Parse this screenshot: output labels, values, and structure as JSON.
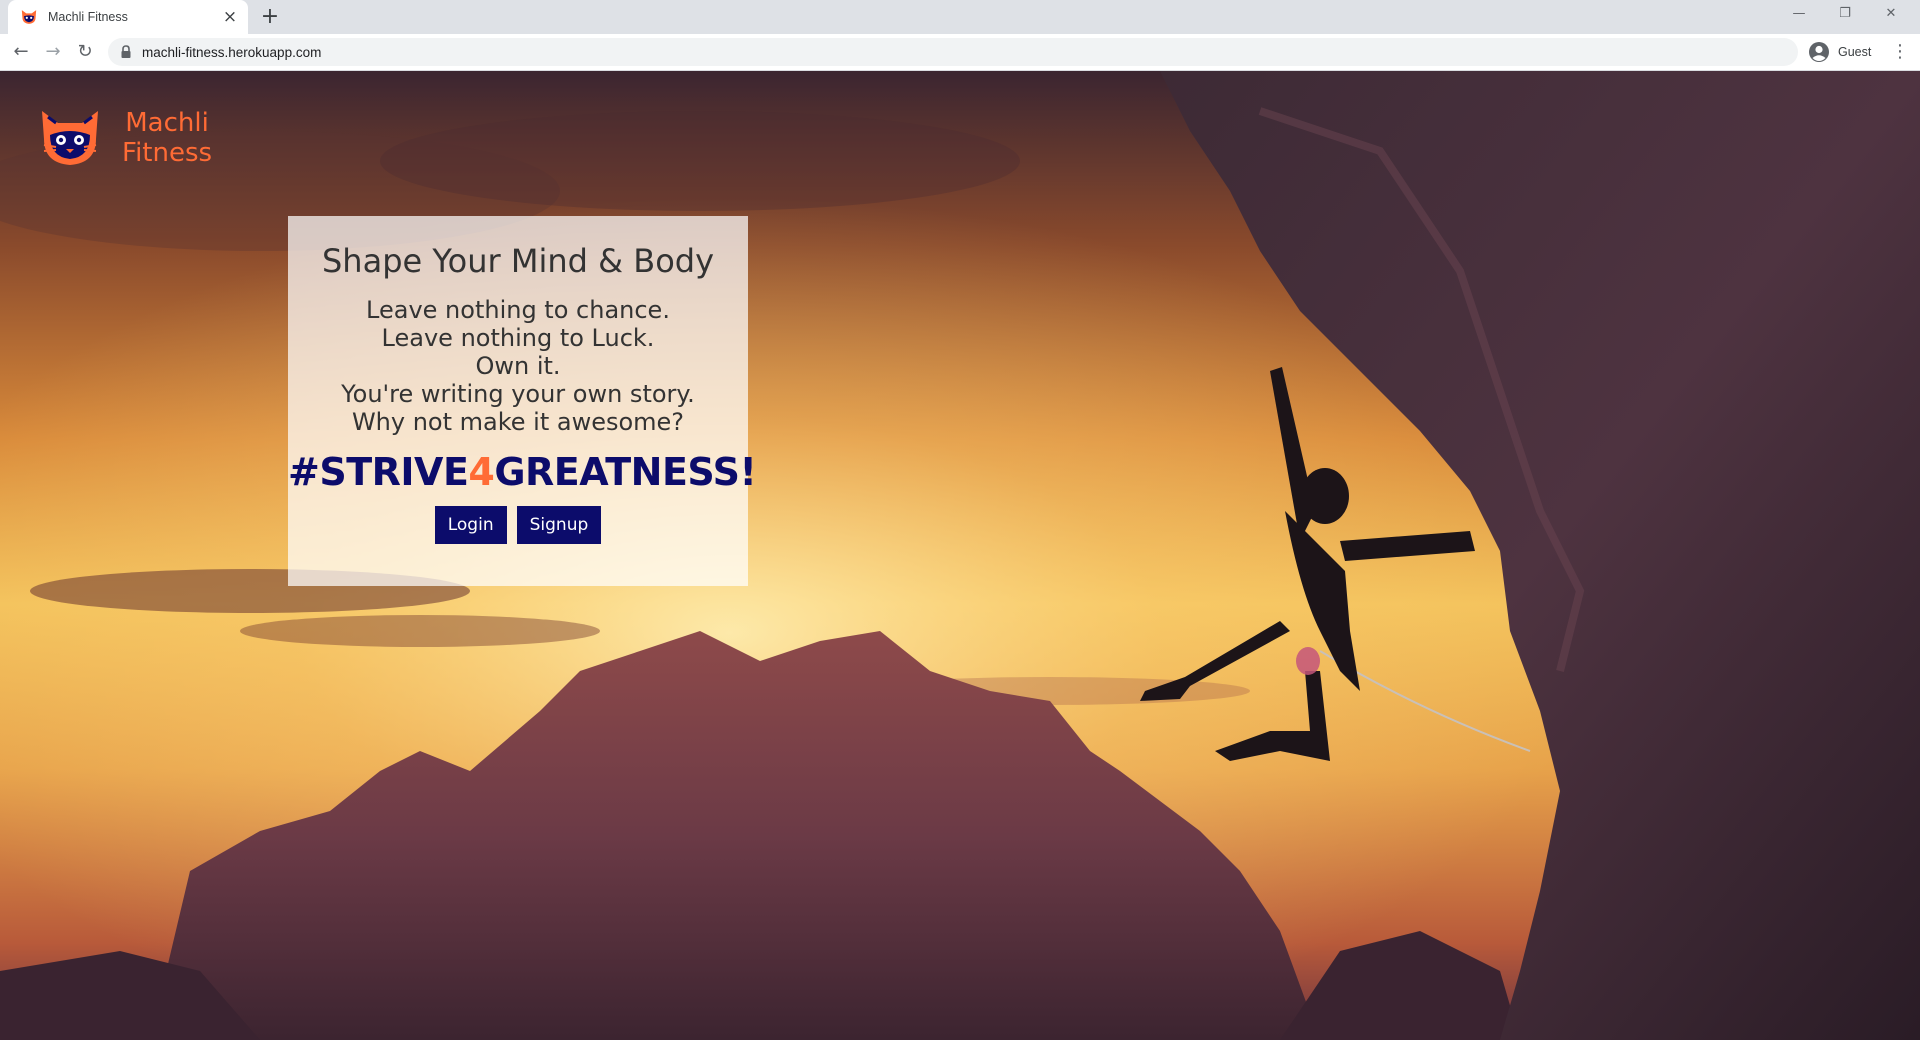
{
  "browser": {
    "tab": {
      "title": "Machli Fitness",
      "close_glyph": "×",
      "favicon": "machli-cat-icon"
    },
    "new_tab_glyph": "+",
    "window_controls": {
      "minimize": "—",
      "restore": "❐",
      "close": "✕"
    },
    "nav": {
      "back": "←",
      "forward": "→",
      "reload": "↻"
    },
    "address": {
      "url": "machli-fitness.herokuapp.com",
      "icon": "lock-icon"
    },
    "profile": {
      "label": "Guest",
      "icon": "account-circle-icon"
    },
    "menu_glyph": "⋮"
  },
  "site": {
    "brand": {
      "line1": "Machli",
      "line2": "Fitness",
      "color": "#ff6b35",
      "logo": "machli-cat-logo"
    },
    "hero": {
      "title": "Shape Your Mind & Body",
      "lines": [
        "Leave nothing to chance.",
        "Leave nothing to Luck.",
        "Own it.",
        "You're writing your own story.",
        "Why not make it awesome?"
      ],
      "tagline": {
        "prefix": "#STRIVE",
        "number": "4",
        "suffix": "GREATNESS!"
      },
      "login_label": "Login",
      "signup_label": "Signup"
    },
    "colors": {
      "primary": "#0c0c6b",
      "accent": "#ff6b35"
    }
  }
}
